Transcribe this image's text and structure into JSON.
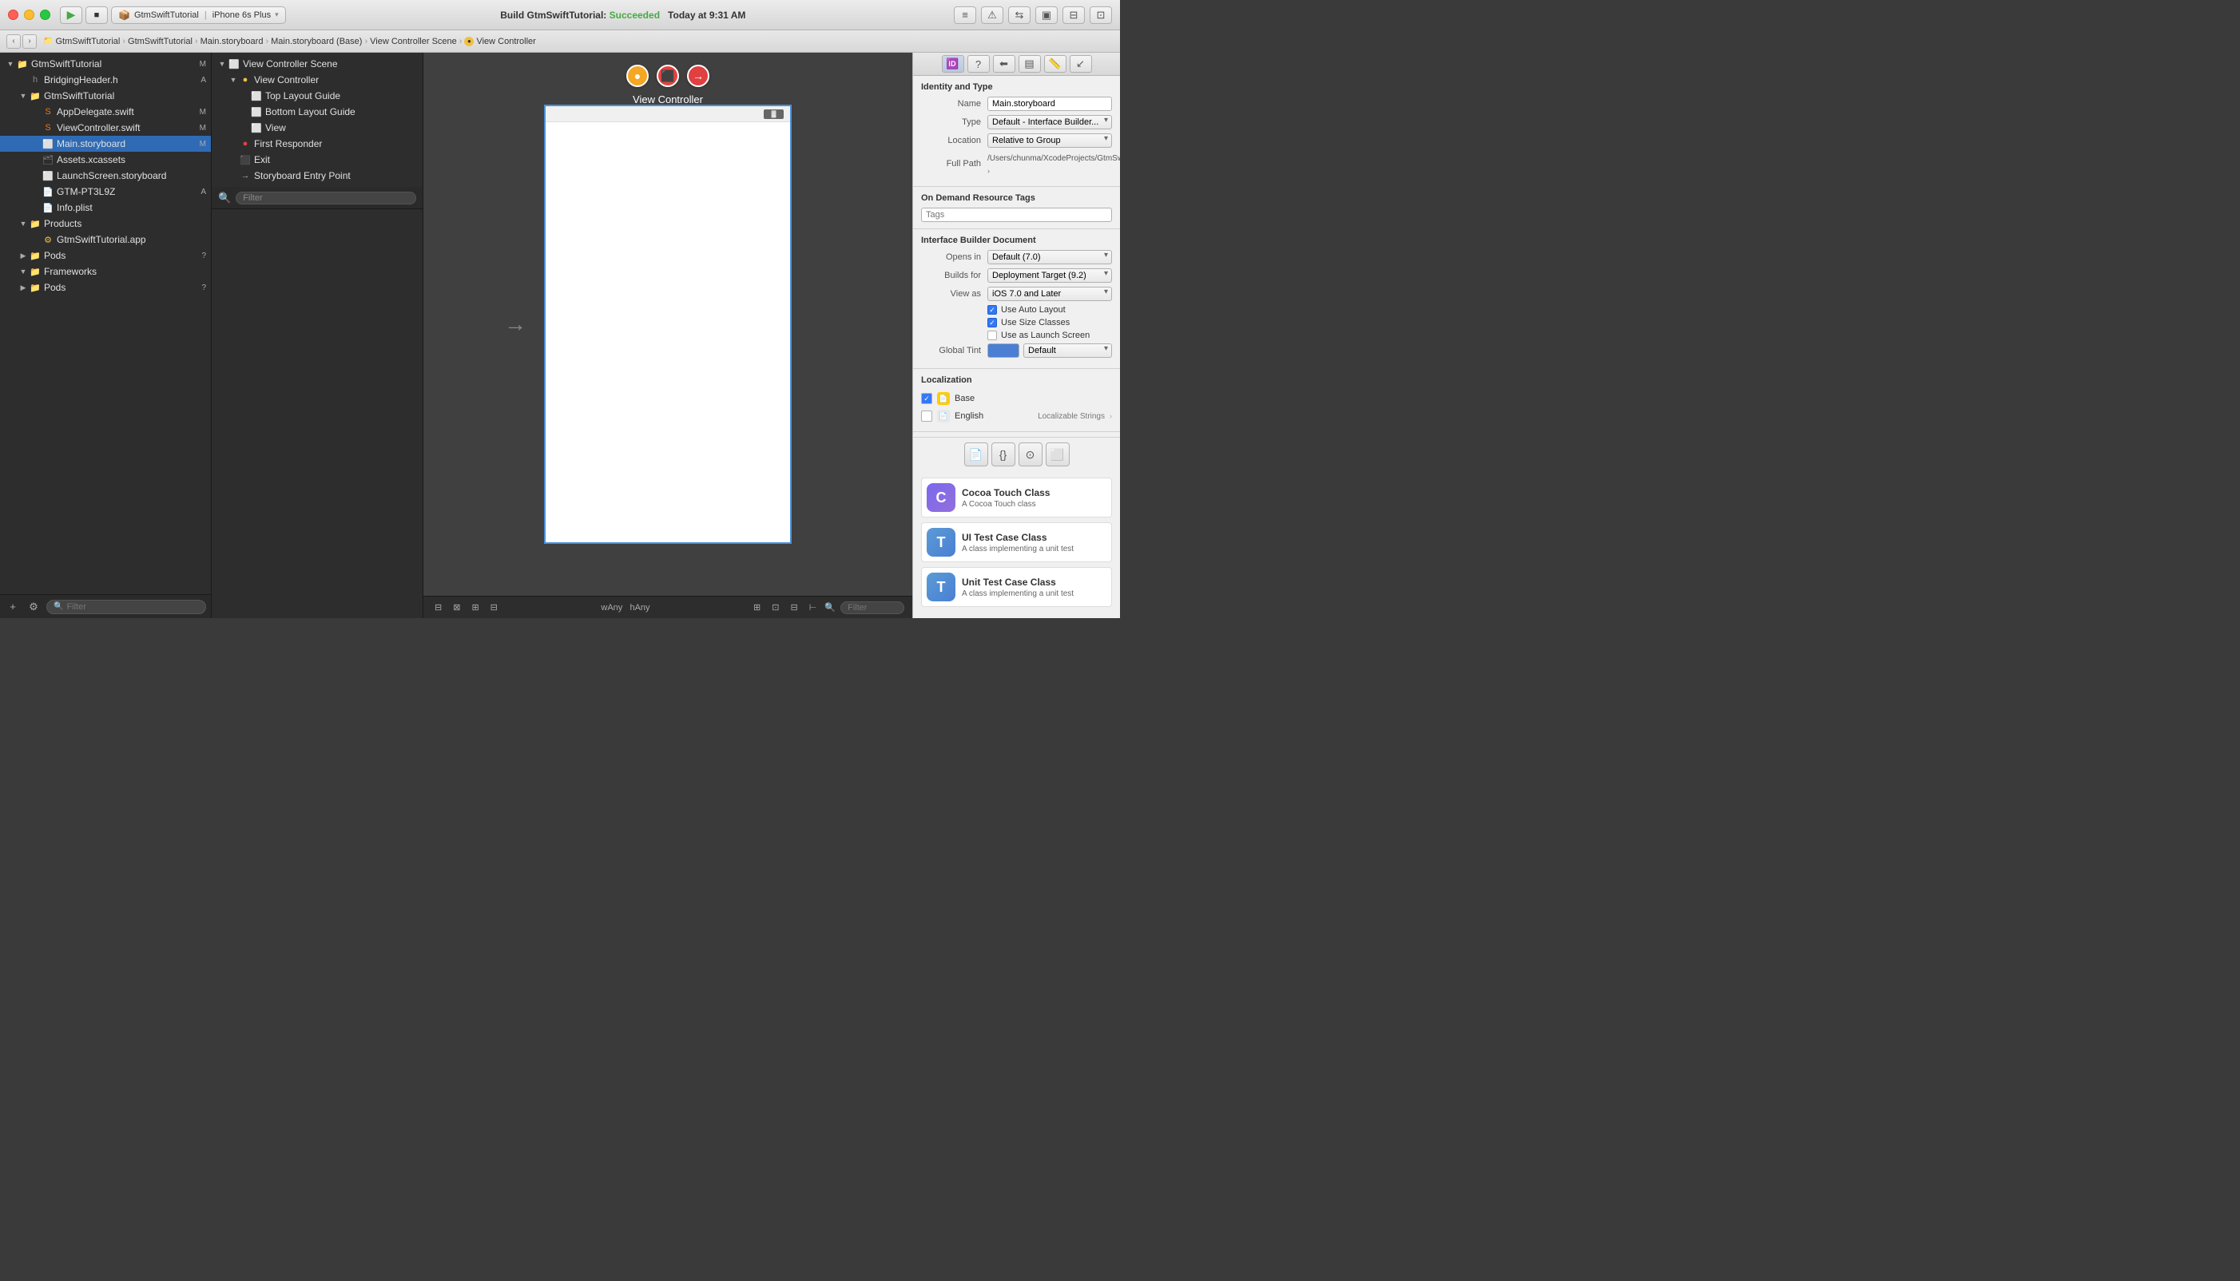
{
  "titlebar": {
    "scheme": "GtmSwiftTutorial",
    "device": "iPhone 6s Plus",
    "build_status": "Build GtmSwiftTutorial:",
    "build_result": "Succeeded",
    "build_time": "Today at 9:31 AM"
  },
  "breadcrumb": {
    "items": [
      "GtmSwiftTutorial",
      "GtmSwiftTutorial",
      "Main.storyboard",
      "Main.storyboard (Base)",
      "View Controller Scene",
      "View Controller"
    ]
  },
  "sidebar": {
    "project_name": "GtmSwiftTutorial",
    "items": [
      {
        "label": "GtmSwiftTutorial",
        "type": "project",
        "indent": 0,
        "expanded": true,
        "badge": "M"
      },
      {
        "label": "BridgingHeader.h",
        "type": "file",
        "indent": 1,
        "badge": "A"
      },
      {
        "label": "GtmSwiftTutorial",
        "type": "folder",
        "indent": 1,
        "expanded": true
      },
      {
        "label": "AppDelegate.swift",
        "type": "swift",
        "indent": 2,
        "badge": "M"
      },
      {
        "label": "ViewController.swift",
        "type": "swift",
        "indent": 2,
        "badge": "M"
      },
      {
        "label": "Main.storyboard",
        "type": "storyboard",
        "indent": 2,
        "badge": "M",
        "selected": true
      },
      {
        "label": "Assets.xcassets",
        "type": "xcassets",
        "indent": 2
      },
      {
        "label": "LaunchScreen.storyboard",
        "type": "storyboard",
        "indent": 2
      },
      {
        "label": "GTM-PT3L9Z",
        "type": "plist",
        "indent": 2,
        "badge": "A"
      },
      {
        "label": "Info.plist",
        "type": "plist",
        "indent": 2
      },
      {
        "label": "Products",
        "type": "folder",
        "indent": 1,
        "expanded": true
      },
      {
        "label": "GtmSwiftTutorial.app",
        "type": "app",
        "indent": 2
      },
      {
        "label": "Pods",
        "type": "folder",
        "indent": 1,
        "badge": "?"
      },
      {
        "label": "Frameworks",
        "type": "folder",
        "indent": 1,
        "expanded": true
      },
      {
        "label": "Pods",
        "type": "folder",
        "indent": 1,
        "badge": "?"
      }
    ]
  },
  "outline": {
    "items": [
      {
        "label": "View Controller Scene",
        "type": "scene",
        "indent": 0,
        "expanded": true
      },
      {
        "label": "View Controller",
        "type": "vc",
        "indent": 1,
        "expanded": true
      },
      {
        "label": "Top Layout Guide",
        "type": "guide",
        "indent": 2
      },
      {
        "label": "Bottom Layout Guide",
        "type": "guide",
        "indent": 2
      },
      {
        "label": "View",
        "type": "view",
        "indent": 2
      },
      {
        "label": "First Responder",
        "type": "responder",
        "indent": 1
      },
      {
        "label": "Exit",
        "type": "exit",
        "indent": 1
      },
      {
        "label": "Storyboard Entry Point",
        "type": "entry",
        "indent": 1
      }
    ],
    "filter_placeholder": "Filter"
  },
  "canvas": {
    "scene_title": "View Controller",
    "wAny": "wAny",
    "hAny": "hAny"
  },
  "rightpanel": {
    "identity_type": {
      "title": "Identity and Type",
      "name_label": "Name",
      "name_value": "Main.storyboard",
      "type_label": "Type",
      "type_value": "Default - Interface Builder...",
      "location_label": "Location",
      "location_value": "Relative to Group",
      "full_path_label": "Full Path",
      "full_path_value": "/Users/chunma/XcodeProjects/GtmSwiftTutorial/GtmSwiftTutorial/Base.lproj/Main.storyboard"
    },
    "on_demand": {
      "title": "On Demand Resource Tags",
      "tags_placeholder": "Tags"
    },
    "ib_document": {
      "title": "Interface Builder Document",
      "opens_in_label": "Opens in",
      "opens_in_value": "Default (7.0)",
      "builds_for_label": "Builds for",
      "builds_for_value": "Deployment Target (9.2)",
      "view_as_label": "View as",
      "view_as_value": "iOS 7.0 and Later",
      "use_auto_layout": true,
      "use_auto_layout_label": "Use Auto Layout",
      "use_size_classes": true,
      "use_size_classes_label": "Use Size Classes",
      "use_launch_screen": false,
      "use_launch_screen_label": "Use as Launch Screen",
      "global_tint_label": "Global Tint",
      "global_tint_value": "Default"
    },
    "localization": {
      "title": "Localization",
      "items": [
        {
          "checked": true,
          "label": "Base",
          "type": ""
        },
        {
          "checked": false,
          "label": "English",
          "type": "Localizable Strings"
        }
      ]
    },
    "snippets": [
      {
        "icon": "C",
        "icon_type": "cocoa",
        "title": "Cocoa Touch Class",
        "desc": "A Cocoa Touch class"
      },
      {
        "icon": "T",
        "icon_type": "test",
        "title": "UI Test Case Class",
        "desc": "A class implementing a unit test"
      },
      {
        "icon": "T",
        "icon_type": "test",
        "title": "Unit Test Case Class",
        "desc": "A class implementing a unit test"
      }
    ]
  },
  "icons": {
    "play": "▶",
    "stop": "■",
    "chevron_left": "‹",
    "chevron_right": "›",
    "arrow_right": "→",
    "check": "✓",
    "search": "🔍",
    "plus": "+",
    "settings": "⚙",
    "expand": "▼",
    "collapse": "▶",
    "file_doc": "📄",
    "folder": "📁"
  }
}
